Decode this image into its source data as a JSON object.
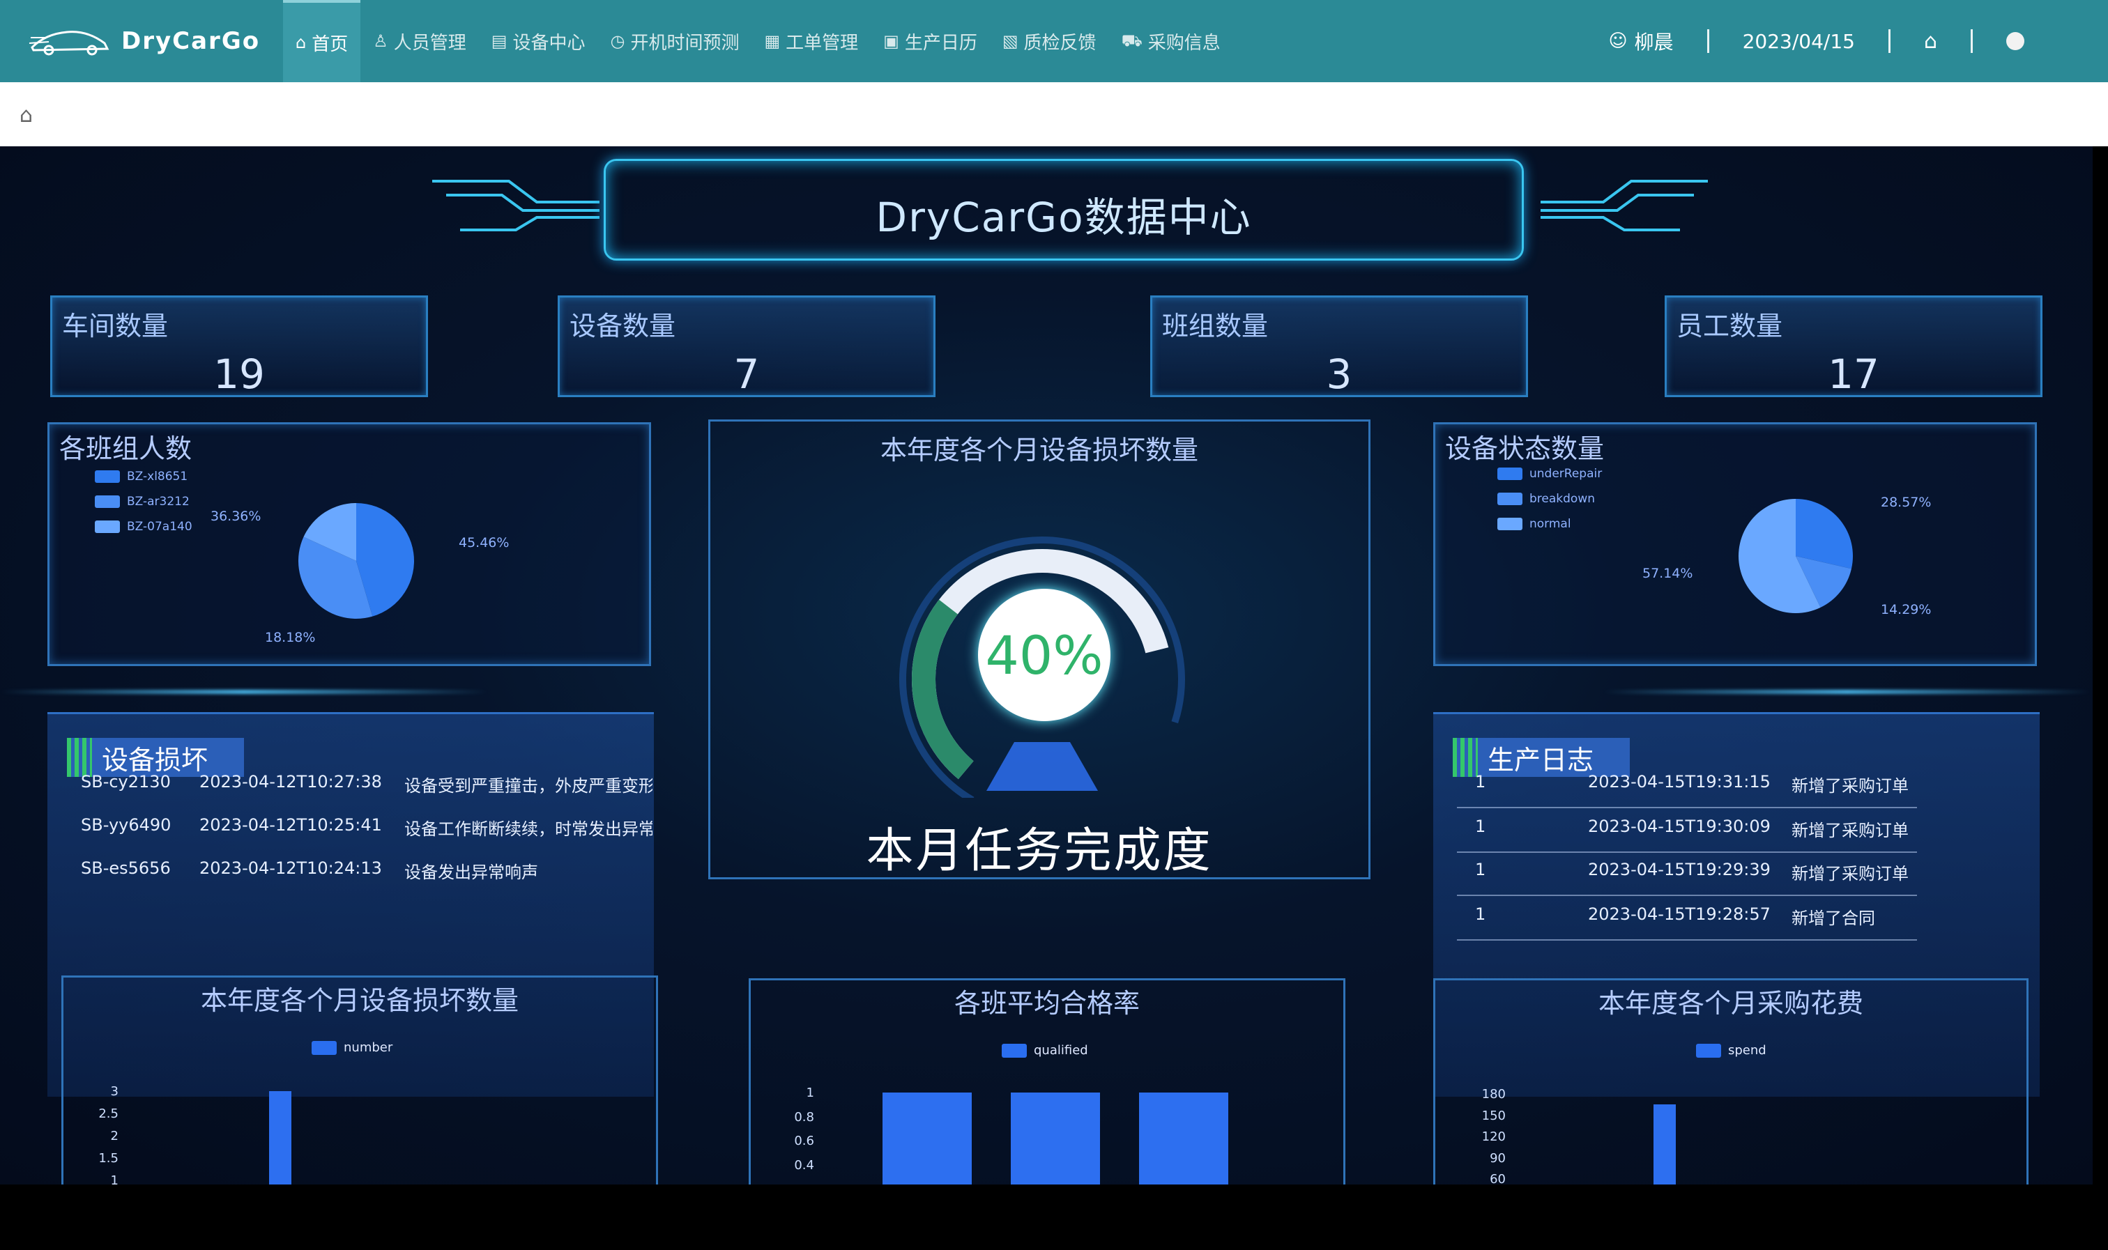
{
  "app": {
    "logo_text": "DryCarGo"
  },
  "nav": {
    "items": [
      {
        "icon": "⌂",
        "label": "首页",
        "active": true
      },
      {
        "icon": "♙",
        "label": "人员管理"
      },
      {
        "icon": "▤",
        "label": "设备中心"
      },
      {
        "icon": "◷",
        "label": "开机时间预测"
      },
      {
        "icon": "▦",
        "label": "工单管理"
      },
      {
        "icon": "▣",
        "label": "生产日历"
      },
      {
        "icon": "▧",
        "label": "质检反馈"
      },
      {
        "icon": "⛟",
        "label": "采购信息"
      }
    ],
    "user": "柳晨",
    "date": "2023/04/15"
  },
  "dashboard": {
    "title": "DryCarGo数据中心",
    "stats": [
      {
        "label": "车间数量",
        "value": "19"
      },
      {
        "label": "设备数量",
        "value": "7"
      },
      {
        "label": "班组数量",
        "value": "3"
      },
      {
        "label": "员工数量",
        "value": "17"
      }
    ],
    "team_panel": {
      "title": "各班组人数",
      "legend": [
        "BZ-xl8651",
        "BZ-ar3212",
        "BZ-07a140"
      ],
      "labels": [
        "36.36%",
        "45.46%",
        "18.18%"
      ]
    },
    "status_panel": {
      "title": "设备状态数量",
      "legend": [
        "underRepair",
        "breakdown",
        "normal"
      ],
      "labels": [
        "28.57%",
        "57.14%",
        "14.29%"
      ]
    },
    "center": {
      "title": "本年度各个月设备损坏数量",
      "percent": "40%",
      "subtitle": "本月任务完成度"
    },
    "damage_list": {
      "title": "设备损坏",
      "rows": [
        {
          "id": "SB-cy2130",
          "time": "2023-04-12T10:27:38",
          "desc": "设备受到严重撞击，外皮严重变形"
        },
        {
          "id": "SB-yy6490",
          "time": "2023-04-12T10:25:41",
          "desc": "设备工作断断续续，时常发出异常"
        },
        {
          "id": "SB-es5656",
          "time": "2023-04-12T10:24:13",
          "desc": "设备发出异常响声"
        }
      ]
    },
    "log_list": {
      "title": "生产日志",
      "rows": [
        {
          "n": "1",
          "time": "2023-04-15T19:31:15",
          "desc": "新增了采购订单"
        },
        {
          "n": "1",
          "time": "2023-04-15T19:30:09",
          "desc": "新增了采购订单"
        },
        {
          "n": "1",
          "time": "2023-04-15T19:29:39",
          "desc": "新增了采购订单"
        },
        {
          "n": "1",
          "time": "2023-04-15T19:28:57",
          "desc": "新增了合同"
        }
      ]
    },
    "bottom_charts": [
      {
        "title": "本年度各个月设备损坏数量",
        "legend": "number",
        "ticks": [
          "3",
          "2.5",
          "2",
          "1.5",
          "1"
        ]
      },
      {
        "title": "各班平均合格率",
        "legend": "qualified",
        "ticks": [
          "1",
          "0.8",
          "0.6",
          "0.4"
        ]
      },
      {
        "title": "本年度各个月采购花费",
        "legend": "spend",
        "ticks": [
          "180",
          "150",
          "120",
          "90",
          "60"
        ]
      }
    ]
  },
  "colors": {
    "nav_bg": "#2b8a96",
    "accent_blue": "#2d6ff0",
    "gauge_green": "#2fb36a",
    "dash_bg": "#06142b"
  },
  "chart_data": [
    {
      "type": "pie",
      "title": "各班组人数",
      "categories": [
        "BZ-xl8651",
        "BZ-ar3212",
        "BZ-07a140"
      ],
      "values": [
        45.46,
        36.36,
        18.18
      ],
      "unit": "%",
      "legend": "top-left"
    },
    {
      "type": "pie",
      "title": "设备状态数量",
      "categories": [
        "underRepair",
        "breakdown",
        "normal"
      ],
      "values": [
        28.57,
        14.29,
        57.14
      ],
      "unit": "%",
      "legend": "top-left"
    },
    {
      "type": "bar",
      "title": "本年度各个月设备损坏数量",
      "series": [
        {
          "name": "number",
          "values": [
            3
          ]
        }
      ],
      "ylim": [
        1,
        3
      ],
      "yticks": [
        1,
        1.5,
        2,
        2.5,
        3
      ]
    },
    {
      "type": "bar",
      "title": "各班平均合格率",
      "series": [
        {
          "name": "qualified",
          "values": [
            1,
            1,
            1
          ]
        }
      ],
      "ylim": [
        0.4,
        1
      ],
      "yticks": [
        0.4,
        0.6,
        0.8,
        1
      ]
    },
    {
      "type": "bar",
      "title": "本年度各个月采购花费",
      "series": [
        {
          "name": "spend",
          "values": [
            165
          ]
        }
      ],
      "ylim": [
        60,
        180
      ],
      "yticks": [
        60,
        90,
        120,
        150,
        180
      ]
    }
  ]
}
